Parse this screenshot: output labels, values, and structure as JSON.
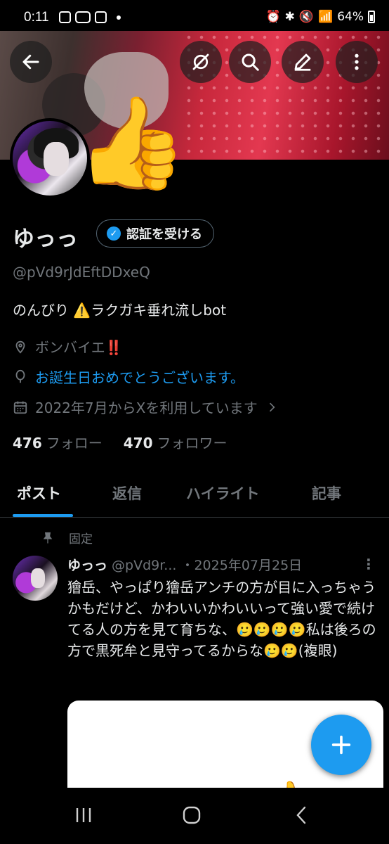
{
  "status_bar": {
    "time": "0:11",
    "battery": "64%"
  },
  "header": {
    "icons": [
      "back-arrow-icon",
      "grok-icon",
      "search-icon",
      "edit-icon",
      "more-vertical-icon"
    ]
  },
  "profile": {
    "name": "ゆっっ",
    "verify_label": "認証を受ける",
    "handle": "@pVd9rJdEftDDxeQ",
    "bio": "のんびり ⚠️ラクガキ垂れ流しbot",
    "location": "ボンバイエ‼️",
    "birthday": "お誕生日おめでとうございます。",
    "joined": "2022年7月からXを利用しています",
    "following_count": "476",
    "following_label": "フォロー",
    "followers_count": "470",
    "followers_label": "フォロワー"
  },
  "tabs": [
    {
      "label": "ポスト",
      "active": true
    },
    {
      "label": "返信",
      "active": false
    },
    {
      "label": "ハイライト",
      "active": false
    },
    {
      "label": "記事",
      "active": false
    }
  ],
  "post": {
    "pinned_label": "固定",
    "author": "ゆっっ",
    "handle": "@pVd9r...",
    "date": "・2025年07月25日",
    "text": "獪岳、やっぱり獪岳アンチの方が目に入っちゃうかもだけど、かわいいかわいいって強い愛で続けてる人の方を見て育ちな、🥲🥲🥲🥲私は後ろの方で黒死牟と見守ってるからな🥲🥲(複眼)"
  },
  "colors": {
    "accent": "#1d9bf0",
    "background": "#000000",
    "muted": "#71767b"
  }
}
